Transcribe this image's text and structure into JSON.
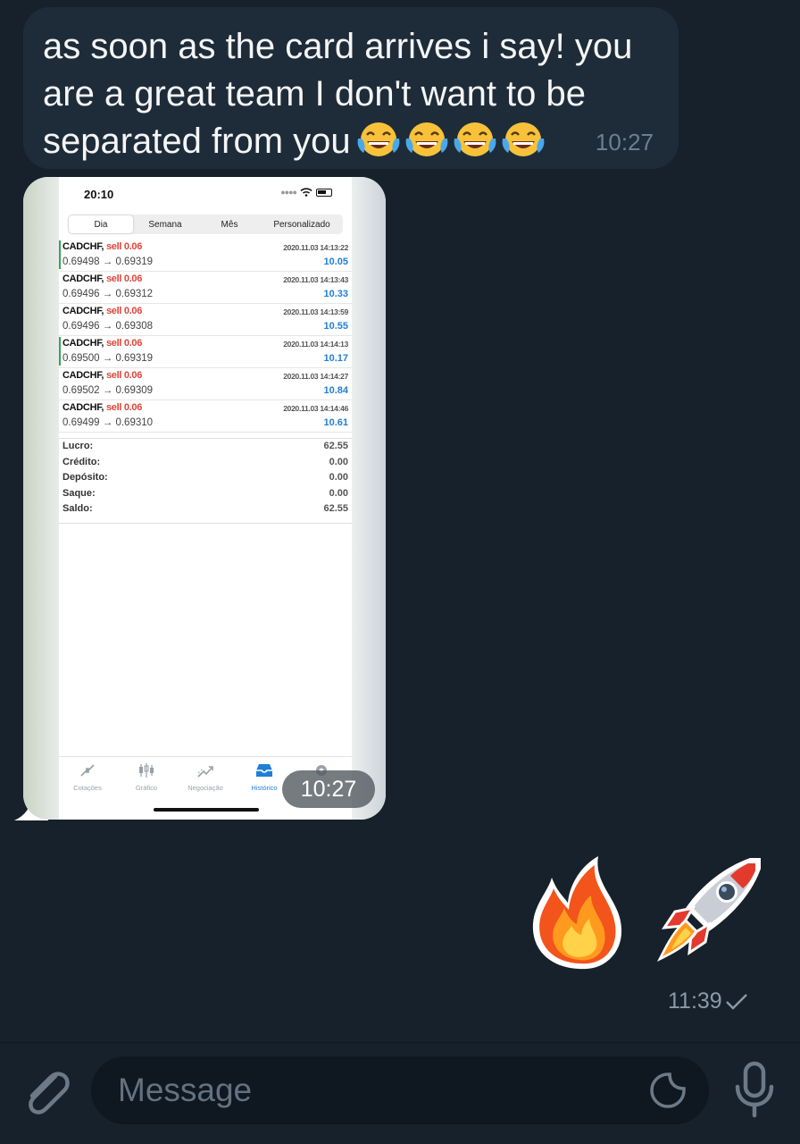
{
  "messages": {
    "incoming_text": {
      "text": "as soon as the card arrives i say!  you are a great team I don't want to be separated from you",
      "emojis": [
        "😂",
        "😂",
        "😂",
        "😂"
      ],
      "time": "10:27"
    },
    "incoming_image": {
      "time": "10:27",
      "screenshot": {
        "status_time": "20:10",
        "segments": [
          "Dia",
          "Semana",
          "Mês",
          "Personalizado"
        ],
        "active_segment": "Dia",
        "deals": [
          {
            "symbol": "CADCHF,",
            "side": "sell 0.06",
            "prices": "0.69498 → 0.69319",
            "date": "2020.11.03 14:13:22",
            "profit": "10.05",
            "marked": true
          },
          {
            "symbol": "CADCHF,",
            "side": "sell 0.06",
            "prices": "0.69496 → 0.69312",
            "date": "2020.11.03 14:13:43",
            "profit": "10.33",
            "marked": false
          },
          {
            "symbol": "CADCHF,",
            "side": "sell 0.06",
            "prices": "0.69496 → 0.69308",
            "date": "2020.11.03 14:13:59",
            "profit": "10.55",
            "marked": false
          },
          {
            "symbol": "CADCHF,",
            "side": "sell 0.06",
            "prices": "0.69500 → 0.69319",
            "date": "2020.11.03 14:14:13",
            "profit": "10.17",
            "marked": true
          },
          {
            "symbol": "CADCHF,",
            "side": "sell 0.06",
            "prices": "0.69502 → 0.69309",
            "date": "2020.11.03 14:14:27",
            "profit": "10.84",
            "marked": false
          },
          {
            "symbol": "CADCHF,",
            "side": "sell 0.06",
            "prices": "0.69499 → 0.69310",
            "date": "2020.11.03 14:14:46",
            "profit": "10.61",
            "marked": false
          }
        ],
        "summary": [
          {
            "label": "Lucro:",
            "value": "62.55"
          },
          {
            "label": "Crédito:",
            "value": "0.00"
          },
          {
            "label": "Depósito:",
            "value": "0.00"
          },
          {
            "label": "Saque:",
            "value": "0.00"
          },
          {
            "label": "Saldo:",
            "value": "62.55"
          }
        ],
        "tabs": [
          {
            "label": "Cotações",
            "icon": "quotes-icon"
          },
          {
            "label": "Gráfico",
            "icon": "chart-icon"
          },
          {
            "label": "Negociação",
            "icon": "trade-icon"
          },
          {
            "label": "Histórico",
            "icon": "history-icon",
            "active": true
          },
          {
            "label": "",
            "icon": "settings-icon"
          }
        ]
      }
    },
    "outgoing_emoji": {
      "emojis": [
        "🔥",
        "🚀"
      ],
      "time": "11:39",
      "status_icon": "sent-check-icon"
    }
  },
  "composer": {
    "placeholder": "Message",
    "attach_icon": "paperclip-icon",
    "sticker_icon": "sticker-icon",
    "mic_icon": "microphone-icon"
  },
  "colors": {
    "background": "#17212b",
    "incoming_bubble": "#1e2c3a",
    "meta_text": "#6d7f8f",
    "profit_blue": "#1f7fd6",
    "sell_red": "#e0443a"
  }
}
